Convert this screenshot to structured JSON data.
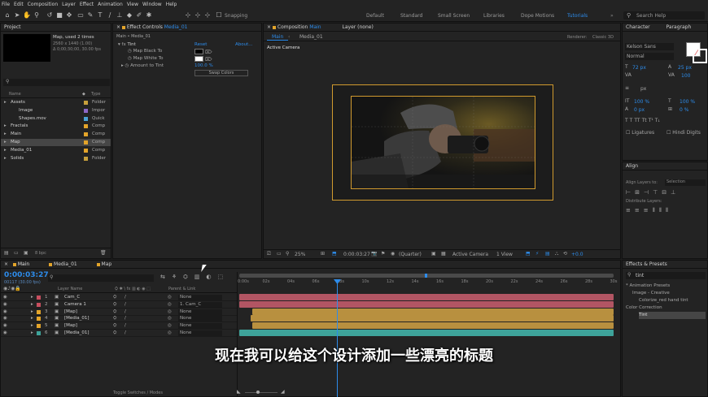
{
  "menu": [
    "File",
    "Edit",
    "Composition",
    "Layer",
    "Effect",
    "Animation",
    "View",
    "Window",
    "Help"
  ],
  "toolbar": {
    "snapping": "Snapping",
    "workspaces": [
      "Default",
      "Standard",
      "Small Screen",
      "Libraries",
      "Dope Motions",
      "Tutorials"
    ],
    "search_help": "Search Help"
  },
  "project": {
    "title": "Project",
    "item_name": "Map",
    "item_used": ", used 2 times",
    "item_size": "2560 x 1440 (1.00)",
    "item_duration": "Δ 0;00;30;00, 30.00 fps",
    "col_name": "Name",
    "col_type": "Type",
    "rows": [
      {
        "name": "Assets",
        "type": "Folder",
        "color": "#c7a03c",
        "indent": 0
      },
      {
        "name": "Image",
        "type": "Impor",
        "color": "#8c67c7",
        "indent": 1
      },
      {
        "name": "Shapes.mov",
        "type": "Quick",
        "color": "#4aa3d6",
        "indent": 1
      },
      {
        "name": "Fractals",
        "type": "Comp",
        "color": "#e3a42a",
        "indent": 0
      },
      {
        "name": "Main",
        "type": "Comp",
        "color": "#e3a42a",
        "indent": 0
      },
      {
        "name": "Map",
        "type": "Comp",
        "color": "#e3a42a",
        "indent": 0
      },
      {
        "name": "Media_01",
        "type": "Comp",
        "color": "#e3a42a",
        "indent": 0
      },
      {
        "name": "Solids",
        "type": "Folder",
        "color": "#c7a03c",
        "indent": 0
      }
    ],
    "bpc": "8 bpc"
  },
  "effect_controls": {
    "tab": "Effect Controls",
    "tab_target": "Media_01",
    "header": "Main • Media_01",
    "fx_name": "Tint",
    "reset": "Reset",
    "about": "About...",
    "map_black": "Map Black To",
    "map_white": "Map White To",
    "amount": "Amount to Tint",
    "amount_value": "100.0 %",
    "swap": "Swap Colors"
  },
  "composition": {
    "tab": "Composition",
    "tab_target": "Main",
    "layer_tab": "Layer (none)",
    "sub_tabs": [
      "Main",
      "Media_01"
    ],
    "renderer_label": "Renderer:",
    "renderer_value": "Classic 3D",
    "active_camera": "Active Camera",
    "zoom": "25%",
    "timecode": "0:00:03:27",
    "resolution": "(Quarter)",
    "camera_view": "Active Camera",
    "views": "1 View",
    "exposure": "+0.0"
  },
  "character": {
    "tab": "Character",
    "tab2": "Paragraph",
    "font": "Kelson Sans",
    "style": "Normal",
    "size": "72 px",
    "leading": "25 px",
    "tracking": "100",
    "stroke_unit": "px",
    "scale_v": "100 %",
    "scale_h": "100 %",
    "baseline": "0 px",
    "tsume": "0 %",
    "ligatures": "Ligatures",
    "hindi": "Hindi Digits"
  },
  "align": {
    "tab": "Align",
    "align_to_label": "Align Layers to:",
    "align_to_value": "Selection",
    "distribute": "Distribute Layers:"
  },
  "effects_presets": {
    "tab": "Effects & Presets",
    "search": "tint",
    "tree": [
      {
        "label": "* Animation Presets",
        "indent": 0
      },
      {
        "label": "Image - Creative",
        "indent": 1
      },
      {
        "label": "Colorize_red hand tint",
        "indent": 2
      },
      {
        "label": "Color Correction",
        "indent": 0
      },
      {
        "label": "Tint",
        "indent": 2
      }
    ]
  },
  "timeline": {
    "tabs": [
      "Main",
      "Media_01",
      "Map"
    ],
    "timecode": "0:00:03:27",
    "frame_info": "00117 (30.00 fps)",
    "col_layer": "Layer Name",
    "col_parent": "Parent & Link",
    "ruler": [
      "0:00s",
      "02s",
      "04s",
      "06s",
      "08s",
      "10s",
      "12s",
      "14s",
      "16s",
      "18s",
      "20s",
      "22s",
      "24s",
      "26s",
      "28s",
      "30s"
    ],
    "layers": [
      {
        "num": "1",
        "name": "Cam_C",
        "parent": "None",
        "color": "#c94f5f",
        "bar": "#b25563"
      },
      {
        "num": "2",
        "name": "Camera 1",
        "parent": "1. Cam_C",
        "color": "#c94f5f",
        "bar": "#b25563"
      },
      {
        "num": "3",
        "name": "[Map]",
        "parent": "None",
        "color": "#e3a42a",
        "bar": "#b8903f"
      },
      {
        "num": "4",
        "name": "[Media_01]",
        "parent": "None",
        "color": "#e3a42a",
        "bar": "#b8903f"
      },
      {
        "num": "5",
        "name": "[Map]",
        "parent": "None",
        "color": "#e3a42a",
        "bar": "#b8903f"
      },
      {
        "num": "6",
        "name": "[Media_01]",
        "parent": "None",
        "color": "#3ea39a",
        "bar": "#3ea39a"
      }
    ],
    "toggle": "Toggle Switches / Modes"
  },
  "subtitle": "现在我可以给这个设计添加一些漂亮的标题",
  "colors": {
    "accent": "#2d8ceb",
    "comp_border": "#d19a2e"
  }
}
